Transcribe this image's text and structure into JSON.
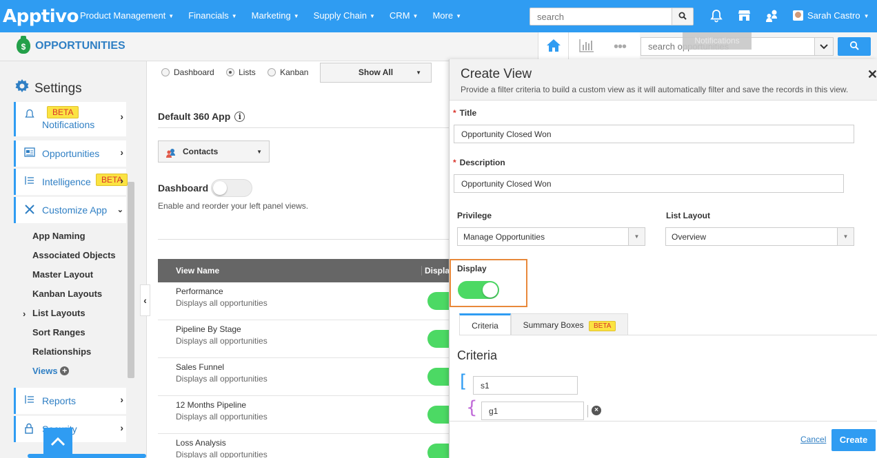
{
  "topnav": {
    "logo": "Apptivo",
    "menu": [
      "Product Management",
      "Financials",
      "Marketing",
      "Supply Chain",
      "CRM",
      "More"
    ],
    "search_placeholder": "search",
    "user": "Sarah Castro",
    "notifications_tooltip": "Notifications",
    "icons": [
      "search-icon",
      "bell-icon",
      "store-icon",
      "people-icon",
      "user-avatar-icon"
    ]
  },
  "app": {
    "title": "OPPORTUNITIES",
    "search_placeholder": "search opportunities"
  },
  "sidebar": {
    "title": "Settings",
    "items": [
      {
        "label": "Notifications",
        "badge": "BETA"
      },
      {
        "label": "Opportunities"
      },
      {
        "label": "Intelligence",
        "badge": "BETA"
      },
      {
        "label": "Customize App"
      }
    ],
    "subitems": [
      "App Naming",
      "Associated Objects",
      "Master Layout",
      "Kanban Layouts",
      "List Layouts",
      "Sort Ranges",
      "Relationships",
      "Views"
    ],
    "bottom_items": [
      {
        "label": "Reports"
      },
      {
        "label": "Security"
      }
    ]
  },
  "main": {
    "view_options": [
      "Dashboard",
      "Lists",
      "Kanban"
    ],
    "selected_view": "Lists",
    "show_all": "Show All",
    "default_app_label": "Default 360 App",
    "contacts_label": "Contacts",
    "dashboard_label": "Dashboard",
    "dashboard_help": "Enable and reorder your left panel views.",
    "table": {
      "headers": [
        "View Name",
        "Display"
      ],
      "rows": [
        {
          "name": "Performance",
          "desc": "Displays all opportunities"
        },
        {
          "name": "Pipeline By Stage",
          "desc": "Displays all opportunities"
        },
        {
          "name": "Sales Funnel",
          "desc": "Displays all opportunities"
        },
        {
          "name": "12 Months Pipeline",
          "desc": "Displays all opportunities"
        },
        {
          "name": "Loss Analysis",
          "desc": "Displays all opportunities"
        }
      ]
    }
  },
  "panel": {
    "title": "Create View",
    "subtitle": "Provide a filter criteria to build a custom view as it will automatically filter and save the records in this view.",
    "title_label": "Title",
    "title_value": "Opportunity Closed Won",
    "description_label": "Description",
    "description_value": "Opportunity Closed Won",
    "privilege_label": "Privilege",
    "privilege_value": "Manage Opportunities",
    "list_layout_label": "List Layout",
    "list_layout_value": "Overview",
    "display_label": "Display",
    "display_on": true,
    "tabs": [
      "Criteria",
      "Summary Boxes"
    ],
    "tab_badge": "BETA",
    "criteria_heading": "Criteria",
    "s1_value": "s1",
    "g1_value": "g1",
    "cancel": "Cancel",
    "create": "Create",
    "close": "✕"
  },
  "colors": {
    "primary": "#2f9cf2",
    "toggle_on": "#4cd964",
    "highlight": "#e8883a",
    "beta": "#fbe342"
  }
}
